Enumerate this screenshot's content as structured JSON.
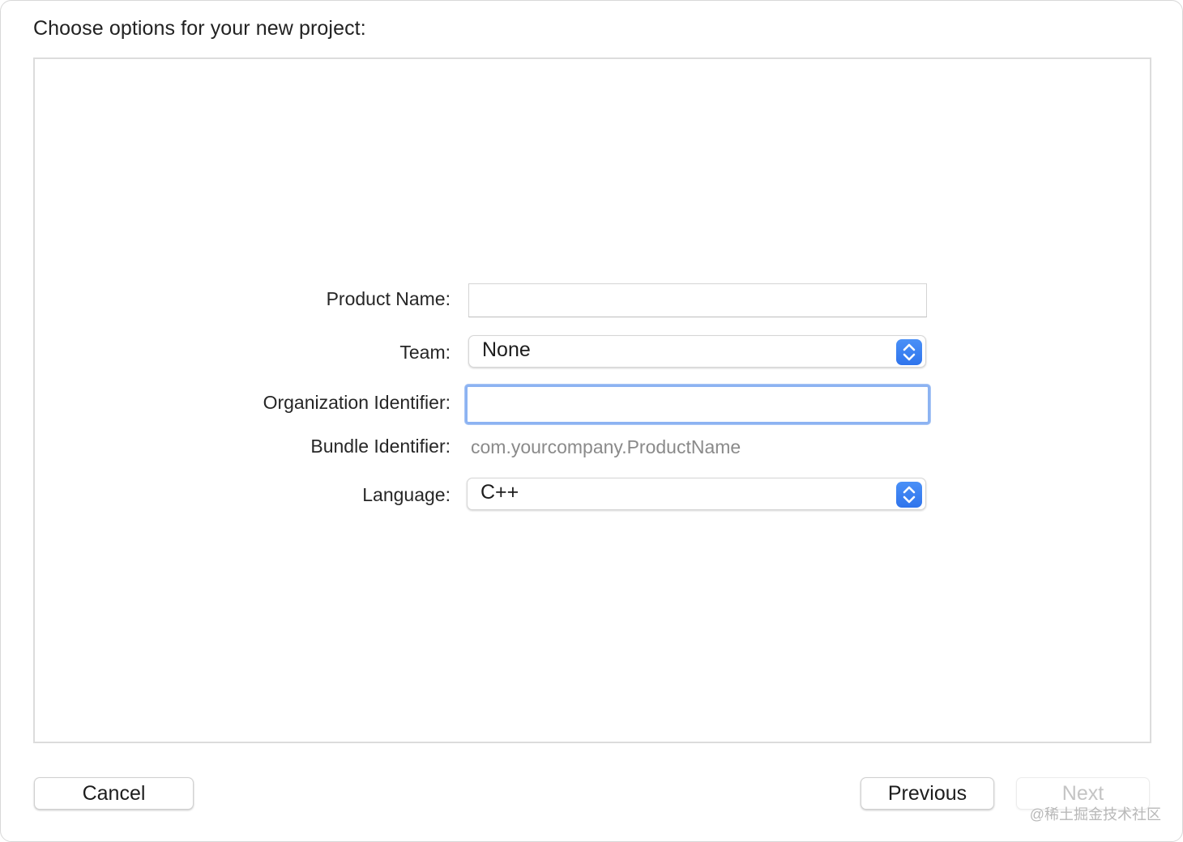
{
  "dialog": {
    "title": "Choose options for your new project:"
  },
  "form": {
    "product_name": {
      "label": "Product Name:",
      "value": "",
      "placeholder": ""
    },
    "team": {
      "label": "Team:",
      "selected": "None"
    },
    "organization_identifier": {
      "label": "Organization Identifier:",
      "value": "",
      "placeholder": ""
    },
    "bundle_identifier": {
      "label": "Bundle Identifier:",
      "value": "com.yourcompany.ProductName"
    },
    "language": {
      "label": "Language:",
      "selected": "C++"
    }
  },
  "footer": {
    "cancel_label": "Cancel",
    "previous_label": "Previous",
    "next_label": "Next"
  },
  "watermark": "@稀土掘金技术社区",
  "icons": {
    "popup_stepper": "chevron-up-down-icon"
  },
  "colors": {
    "accent": "#3B82F6",
    "focus_ring": "#8CB3F2",
    "secondary_text": "#8A8A8A",
    "disabled_text": "#C4C4C4"
  }
}
